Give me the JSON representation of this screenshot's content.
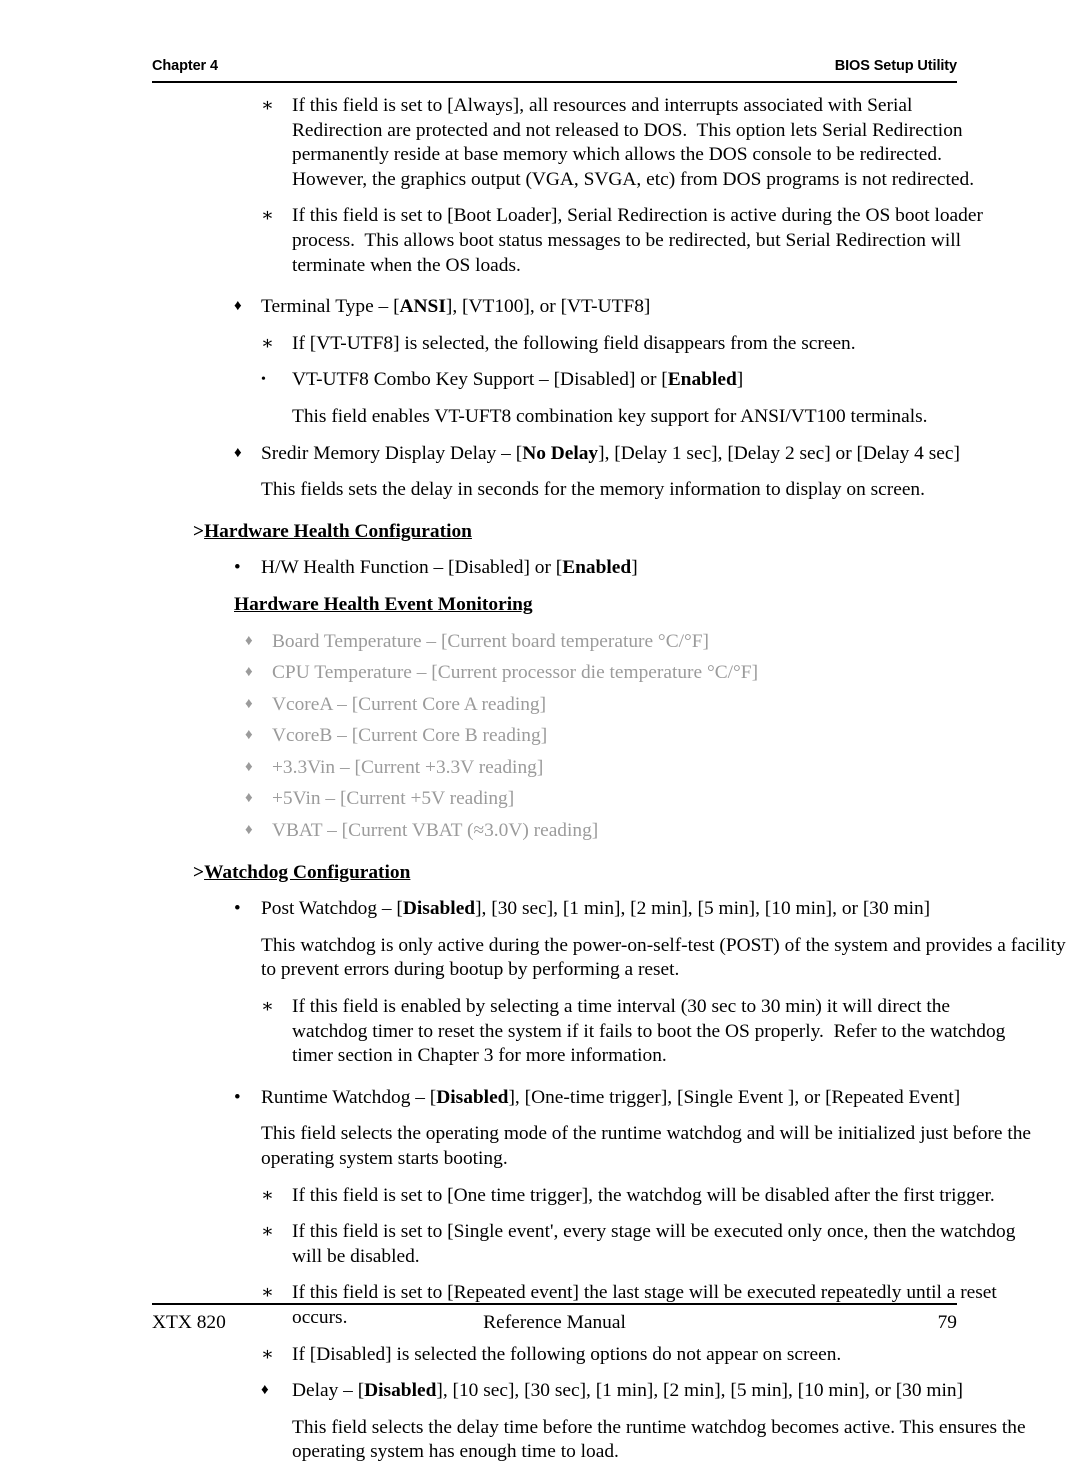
{
  "header": {
    "left": "Chapter 4",
    "right": "BIOS Setup Utility"
  },
  "footer": {
    "left": "XTX 820",
    "center": "Reference Manual",
    "right": "79"
  },
  "markers": {
    "diamond": "♦",
    "bullet": "•",
    "small_bullet": "•",
    "asterisk": "∗"
  },
  "content": {
    "always_note": {
      "line1": "If this field is set to [Always], all resources and interrupts associated with Serial",
      "line2": "Redirection are protected and not released to DOS.  This option lets Serial Redirection",
      "line3": "permanently reside at base memory which allows the DOS console to be redirected.",
      "line4": "However, the graphics output (VGA, SVGA, etc) from DOS programs is not redirected."
    },
    "bootloader_note": {
      "line1": "If this field is set to [Boot Loader], Serial Redirection is active during the OS boot loader",
      "line2": "process.  This allows boot status messages to be redirected, but Serial Redirection will",
      "line3": "terminate when the OS loads."
    },
    "terminal_type": {
      "pre": "Terminal Type – [",
      "bold": "ANSI",
      "post": "], [VT100], or [VT-UTF8]"
    },
    "vtutf8_note": "If [VT-UTF8] is selected, the following field disappears from the screen.",
    "combo_key": {
      "pre": "VT-UTF8 Combo Key Support – [Disabled] or [",
      "bold": "Enabled",
      "post": "]"
    },
    "combo_key_desc": "This field enables VT-UFT8 combination key support for ANSI/VT100 terminals.",
    "sredir_delay": {
      "pre": "Sredir Memory Display Delay – [",
      "bold": "No Delay",
      "post": "], [Delay 1 sec], [Delay 2 sec] or [Delay 4 sec]"
    },
    "sredir_delay_desc": "This fields sets the delay in seconds for the memory information to display on screen.",
    "hw_health_config_heading": {
      "prefix": ">",
      "text": "Hardware Health Configuration"
    },
    "hw_health_function": {
      "pre": "H/W Health Function – [Disabled] or [",
      "bold": "Enabled",
      "post": "]"
    },
    "hw_health_event_monitoring": "Hardware Health Event Monitoring",
    "hw_readings": [
      "Board Temperature – [Current board temperature °C/°F]",
      "CPU Temperature – [Current processor die temperature °C/°F]",
      "VcoreA – [Current Core A reading]",
      "VcoreB – [Current Core B  reading]",
      "+3.3Vin – [Current +3.3V reading]",
      "+5Vin – [Current +5V reading]",
      "VBAT – [Current VBAT (≈3.0V) reading]"
    ],
    "watchdog_config_heading": {
      "prefix": ">",
      "text": "Watchdog Configuration"
    },
    "post_watchdog": {
      "pre": "Post Watchdog – [",
      "bold": "Disabled",
      "post": "], [30 sec], [1 min], [2 min], [5 min], [10 min], or [30 min]"
    },
    "post_watchdog_desc": {
      "line1": "This watchdog is only active during the power-on-self-test (POST) of the system and provides a",
      "line2": "facility to prevent errors during bootup by performing a reset."
    },
    "post_watchdog_note": {
      "line1": "If this field is enabled by selecting a time interval (30 sec to 30 min) it will direct the",
      "line2": "watchdog timer to reset the system if it fails to boot the OS properly.  Refer to the watchdog",
      "line3": "timer section in Chapter 3 for more information."
    },
    "runtime_watchdog": {
      "pre": "Runtime Watchdog – [",
      "bold": "Disabled",
      "post": "], [One-time trigger], [Single Event ], or [Repeated Event]"
    },
    "runtime_watchdog_desc": {
      "line1": "This field selects the operating mode of the runtime watchdog and will be initialized just before",
      "line2": "the operating system starts booting."
    },
    "runtime_note_1": "If this field is set to [One time trigger], the watchdog will be disabled after the first trigger.",
    "runtime_note_2": {
      "line1": "If this field is set to [Single event', every stage will be executed only once, then the watchdog",
      "line2": "will be disabled."
    },
    "runtime_note_3": {
      "line1": "If this field is set to [Repeated event] the last stage will be executed repeatedly until a reset",
      "line2": "occurs."
    },
    "runtime_note_4": "If [Disabled] is selected the following options do not appear on screen.",
    "delay": {
      "pre": "Delay – [",
      "bold": "Disabled",
      "post": "], [10 sec], [30 sec], [1 min], [2 min], [5 min], [10 min], or [30 min]"
    },
    "delay_desc": {
      "line1": "This field selects the delay time before the runtime watchdog becomes active.  This ensures",
      "line2": "the operating system has enough time to load."
    }
  }
}
